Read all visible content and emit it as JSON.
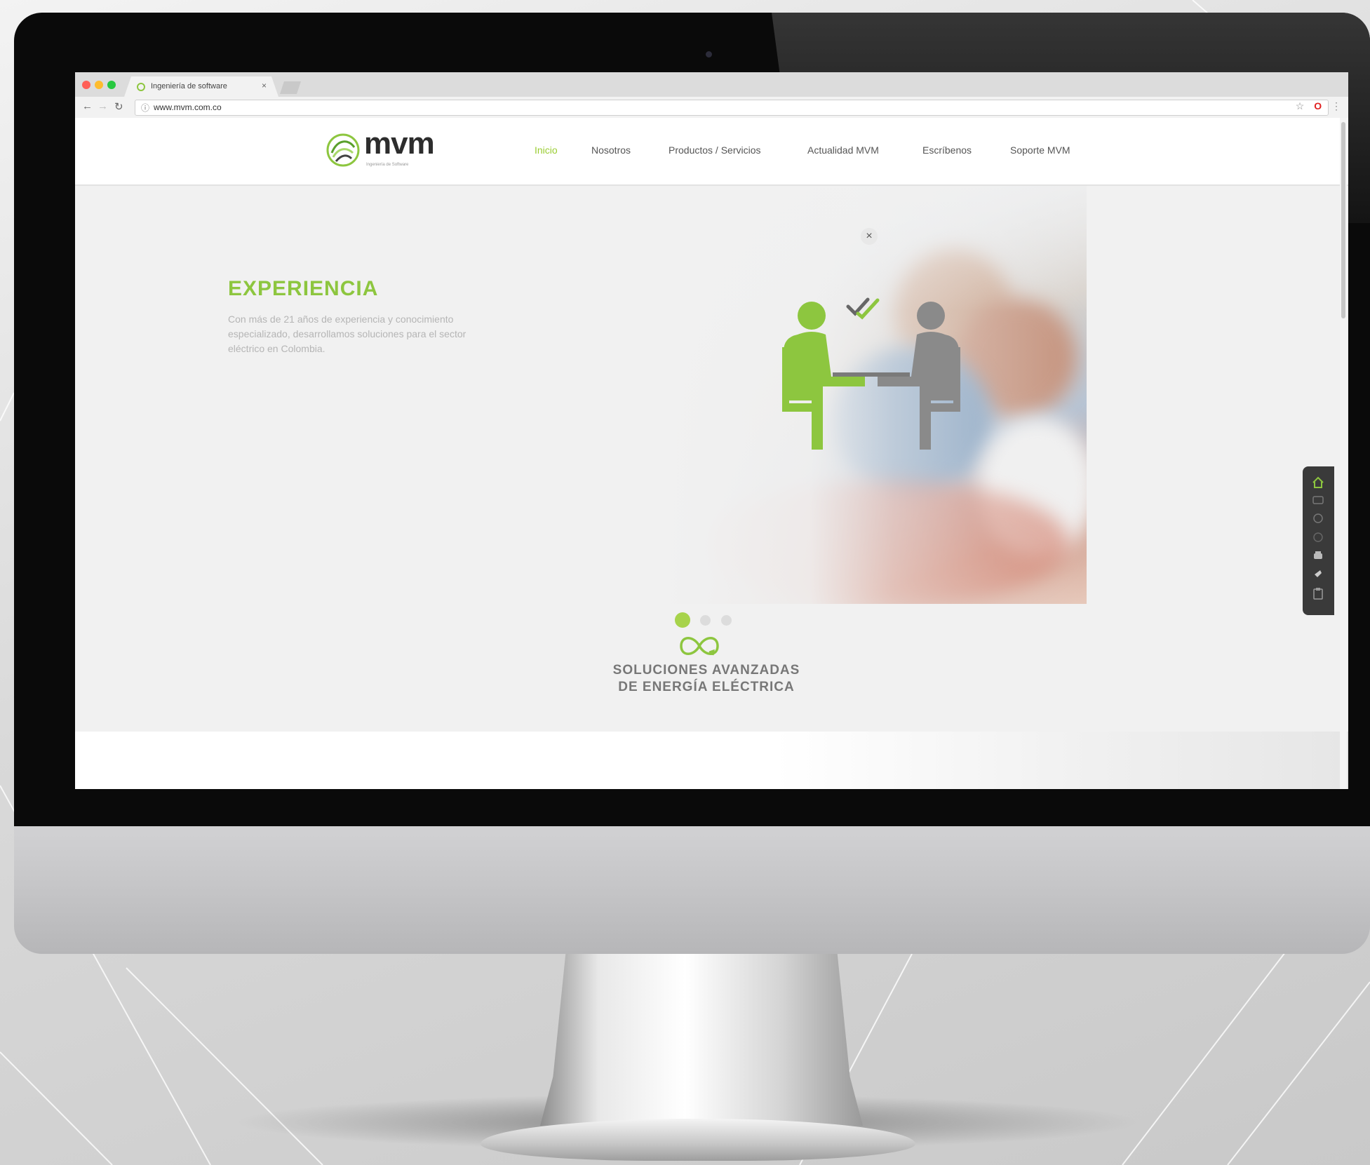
{
  "browser": {
    "tab_title": "Ingeniería de software",
    "tab_close": "×",
    "url_info": "ⓘ",
    "url": "www.mvm.com.co",
    "star": "☆",
    "opera": "O",
    "menu": "⋮"
  },
  "site": {
    "logo_text": "mvm",
    "logo_tagline": "Ingeniería de Software",
    "nav": [
      "Inicio",
      "Nosotros",
      "Productos / Servicios",
      "Actualidad MVM",
      "Escríbenos",
      "Soporte MVM"
    ],
    "active_nav": "Inicio",
    "accent_color": "#8dc63f"
  },
  "hero": {
    "title": "EXPERIENCIA",
    "text": "Con más de 21 años de experiencia y conocimiento especializado, desarrollamos soluciones para el sector eléctrico en Colombia.",
    "close": "×",
    "slide_count": 3,
    "active_slide": 1
  },
  "brand": {
    "line1": "SOLUCIONES AVANZADAS",
    "line2": "DE ENERGÍA ELÉCTRICA"
  },
  "icons": [
    "home-icon",
    "chat-icon",
    "chat-bubble-icon",
    "chat-icon-2",
    "phone-icon",
    "hand-icon",
    "clipboard-icon"
  ]
}
